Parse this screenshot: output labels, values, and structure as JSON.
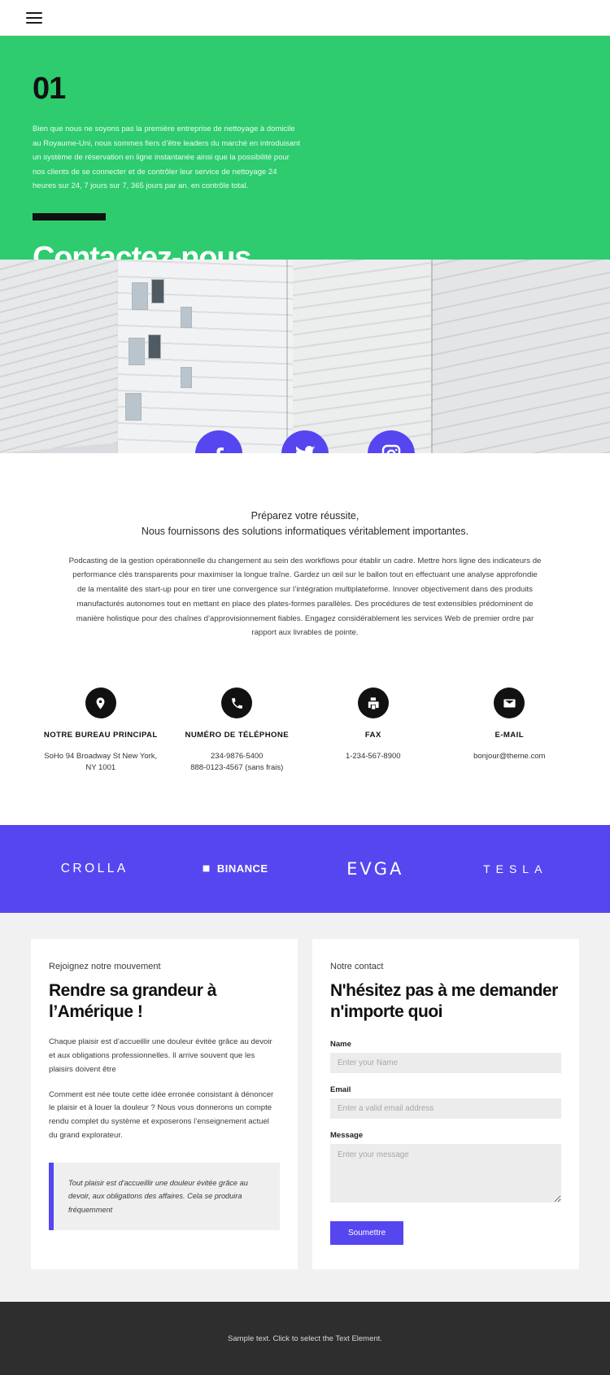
{
  "topbar": {
    "menu_icon": "hamburger-icon"
  },
  "hero": {
    "number": "01",
    "paragraph": "Bien que nous ne soyons pas la première entreprise de nettoyage à domicile au Royaume-Uni, nous sommes fiers d’être leaders du marché en introduisant un système de réservation en ligne instantanée ainsi que la possibilité pour nos clients de se connecter et de contrôler leur service de nettoyage 24 heures sur 24, 7 jours sur 7, 365 jours par an. en contrôle total.",
    "title": "Contactez-nous",
    "bg_color": "#2ecc6f"
  },
  "social": [
    {
      "name": "facebook-icon",
      "label": "Facebook"
    },
    {
      "name": "twitter-icon",
      "label": "Twitter"
    },
    {
      "name": "instagram-icon",
      "label": "Instagram"
    }
  ],
  "intro": {
    "lead_line1": "Préparez votre réussite,",
    "lead_line2": "Nous fournissons des solutions informatiques véritablement importantes.",
    "body": "Podcasting de la gestion opérationnelle du changement au sein des workflows pour établir un cadre. Mettre hors ligne des indicateurs de performance clés transparents pour maximiser la longue traîne. Gardez un œil sur le ballon tout en effectuant une analyse approfondie de la mentalité des start-up pour en tirer une convergence sur l’intégration multiplateforme. Innover objectivement dans des produits manufacturés autonomes tout en mettant en place des plates-formes parallèles. Des procédures de test extensibles prédominent de manière holistique pour des chaînes d’approvisionnement fiables. Engagez considérablement les services Web de premier ordre par rapport aux livrables de pointe."
  },
  "contacts": [
    {
      "icon": "location-pin-icon",
      "title": "NOTRE BUREAU PRINCIPAL",
      "value": "SoHo 94 Broadway St New York, NY 1001"
    },
    {
      "icon": "phone-icon",
      "title": "NUMÉRO DE TÉLÉPHONE",
      "value": "234-9876-5400\n888-0123-4567 (sans frais)"
    },
    {
      "icon": "fax-icon",
      "title": "FAX",
      "value": "1-234-567-8900"
    },
    {
      "icon": "envelope-icon",
      "title": "E-MAIL",
      "value": "bonjour@theme.com"
    }
  ],
  "brands": {
    "bg_color": "#5646f0",
    "items": [
      {
        "name": "crolla-logo",
        "label": "CROLLA"
      },
      {
        "name": "binance-logo",
        "label": "BINANCE"
      },
      {
        "name": "evga-logo",
        "label": "EVGA"
      },
      {
        "name": "tesla-logo",
        "label": "TESLA"
      }
    ]
  },
  "left_card": {
    "eyebrow": "Rejoignez notre mouvement",
    "heading": "Rendre sa grandeur à l’Amérique !",
    "para1": "Chaque plaisir est d’accueillir une douleur évitée grâce au devoir et aux obligations professionnelles. Il arrive souvent que les plaisirs doivent être",
    "para2": "Comment est née toute cette idée erronée consistant à dénoncer le plaisir et à louer la douleur ? Nous vous donnerons un compte rendu complet du système et exposerons l’enseignement actuel du grand explorateur.",
    "quote": "Tout plaisir est d’accueillir une douleur évitée grâce au devoir, aux obligations des affaires. Cela se produira fréquemment"
  },
  "form_card": {
    "eyebrow": "Notre contact",
    "heading": "N'hésitez pas à me demander n'importe quoi",
    "name_label": "Name",
    "name_placeholder": "Enter your Name",
    "name_value": "",
    "email_label": "Email",
    "email_placeholder": "Enter a valid email address",
    "email_value": "",
    "message_label": "Message",
    "message_placeholder": "Enter your message",
    "message_value": "",
    "submit_label": "Soumettre",
    "accent_color": "#5646f0"
  },
  "footer": {
    "text": "Sample text. Click to select the Text Element.",
    "bg_color": "#2e2e2e"
  }
}
